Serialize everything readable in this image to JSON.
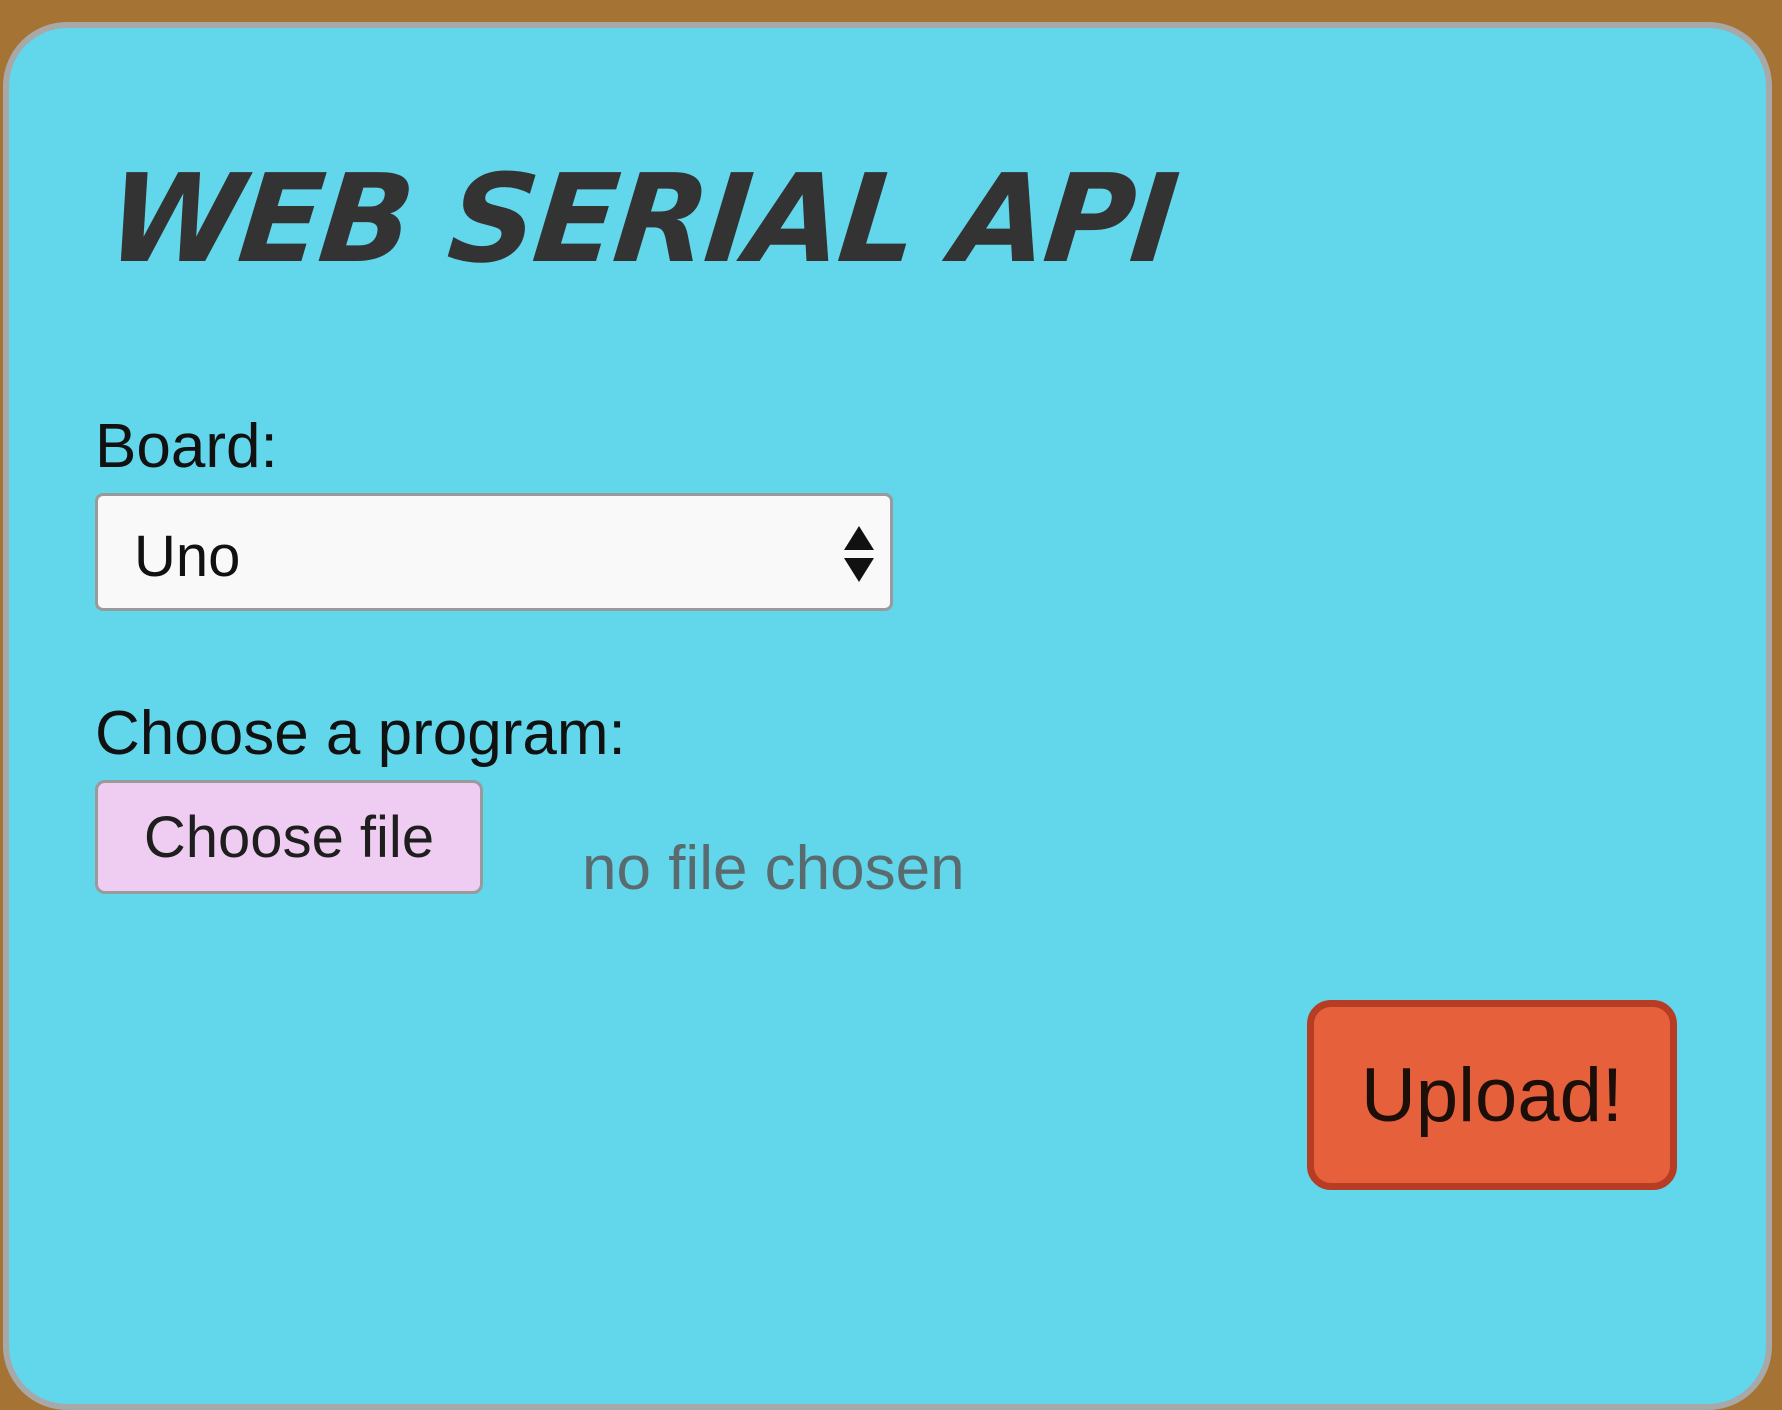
{
  "title": "WEB SERIAL API",
  "board": {
    "label": "Board:",
    "selected": "Uno"
  },
  "program": {
    "label": "Choose a program:",
    "choose_button_label": "Choose file",
    "file_status": "no file chosen"
  },
  "upload": {
    "label": "Upload!"
  },
  "colors": {
    "page_background": "#a57434",
    "card_background": "#62d6ea",
    "title_text": "#333333",
    "choose_button_background": "#efcdf2",
    "upload_button_background": "#e6603b",
    "upload_button_border": "#b63c23"
  },
  "icons": {
    "select_arrows": "up-down-arrows-icon"
  }
}
